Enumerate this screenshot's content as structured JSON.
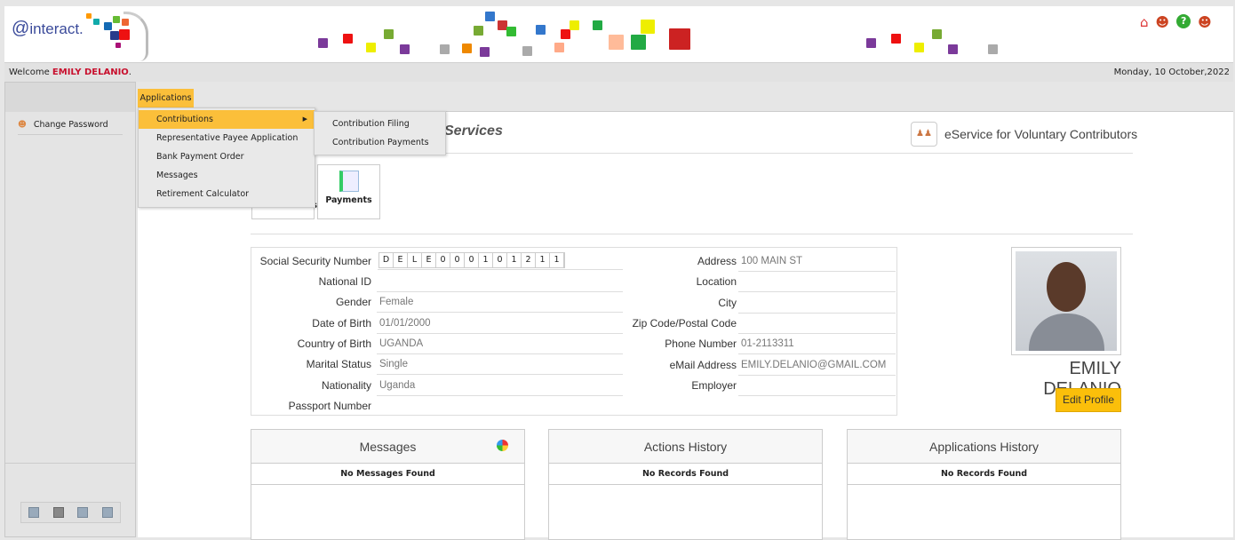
{
  "header": {
    "logo_text": "interact.",
    "icons": [
      "home-icon",
      "support-agent-icon",
      "help-icon",
      "logout-user-icon"
    ]
  },
  "welcome": {
    "prefix": "Welcome ",
    "user": "EMILY DELANIO",
    "suffix": ".",
    "date": "Monday, 10 October,2022"
  },
  "sidebar": {
    "items": [
      {
        "label": "Change Password",
        "icon": "user-lock-icon"
      }
    ],
    "footer_icons": [
      "report-icon",
      "user-report-icon",
      "report-icon",
      "report-icon"
    ]
  },
  "menubar": {
    "tab": "Applications"
  },
  "dropdown": {
    "items": [
      "Contributions",
      "Representative Payee Application",
      "Bank Payment Order",
      "Messages",
      "Retirement Calculator"
    ]
  },
  "submenu": {
    "items": [
      "Contribution Filing",
      "Contribution Payments"
    ]
  },
  "page": {
    "title": "Services",
    "service_label": "eService for Voluntary Contributors"
  },
  "tiles": [
    {
      "label": "Contributions"
    },
    {
      "label": "Payments"
    }
  ],
  "profile": {
    "ssn_label": "Social Security Number",
    "ssn": [
      "D",
      "E",
      "L",
      "E",
      "0",
      "0",
      "0",
      "1",
      "0",
      "1",
      "2",
      "1",
      "1"
    ],
    "left": [
      {
        "label": "National ID",
        "value": ""
      },
      {
        "label": "Gender",
        "value": "Female"
      },
      {
        "label": "Date of Birth",
        "value": "01/01/2000"
      },
      {
        "label": "Country of Birth",
        "value": "UGANDA"
      },
      {
        "label": "Marital Status",
        "value": "Single"
      },
      {
        "label": "Nationality",
        "value": "Uganda"
      },
      {
        "label": "Passport Number",
        "value": ""
      }
    ],
    "right": [
      {
        "label": "Address",
        "value": "100 MAIN ST"
      },
      {
        "label": "Location",
        "value": ""
      },
      {
        "label": "City",
        "value": ""
      },
      {
        "label": "Zip Code/Postal Code",
        "value": ""
      },
      {
        "label": "Phone Number",
        "value": "01-2113311"
      },
      {
        "label": "eMail Address",
        "value": "EMILY.DELANIO@GMAIL.COM"
      },
      {
        "label": "Employer",
        "value": ""
      }
    ],
    "name": "EMILY DELANIO",
    "edit_button": "Edit Profile"
  },
  "panels": [
    {
      "title": "Messages",
      "empty": "No Messages Found"
    },
    {
      "title": "Actions History",
      "empty": "No Records Found"
    },
    {
      "title": "Applications History",
      "empty": "No Records Found"
    }
  ],
  "colors": {
    "accent": "#fbbf3a",
    "welcome_name": "#c8102e"
  }
}
